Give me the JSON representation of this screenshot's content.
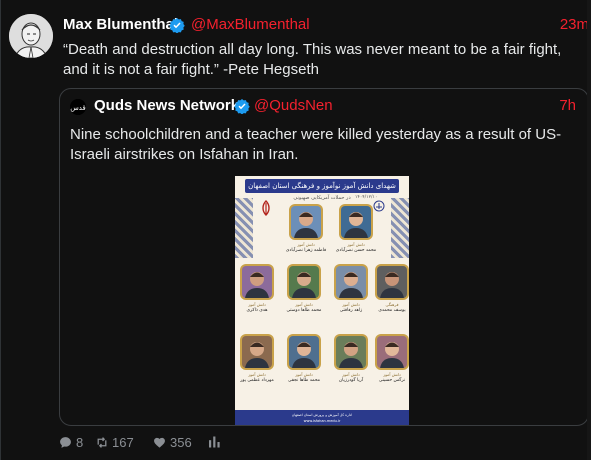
{
  "post": {
    "author_name": "Max Blumenthal",
    "author_handle": "@MaxBlumenthal",
    "time": "23m",
    "text": "“Death and destruction all day long. This was never meant to be a fair fight, and it is not a fair fight.” -Pete Hegseth",
    "counts": {
      "replies": "8",
      "reposts": "167",
      "likes": "356"
    }
  },
  "quote": {
    "author_name": "Quds News Network",
    "author_handle": "@QudsNen",
    "time": "7h",
    "text": "Nine schoolchildren and a teacher were killed yesterday as a result of  US-Israeli airstrikes on Isfahan in Iran.",
    "avatar_label": "قدس"
  },
  "poster": {
    "title": "شهدای دانش آموز نوآموز و فرهنگی استان اصفهان",
    "subtitle": "در حملات آمریکایی صهیونی",
    "date": "۱۴۰۴/۱۲/۱۰",
    "people": [
      {
        "role": "دانش آموز",
        "name": "فاطمه زهرا نصرآبادی"
      },
      {
        "role": "دانش آموز",
        "name": "محمد حسن نصرآبادی"
      },
      {
        "role": "دانش آموز",
        "name": "هدی ذاکری"
      },
      {
        "role": "دانش آموز",
        "name": "محمد طاها دوستی"
      },
      {
        "role": "دانش آموز",
        "name": "زاهد رفاقتی"
      },
      {
        "role": "فرهنگی",
        "name": "یوسف محمدی"
      },
      {
        "role": "دانش آموز",
        "name": "مهرداد عظمی پور"
      },
      {
        "role": "دانش آموز",
        "name": "محمد طاها نجفی"
      },
      {
        "role": "دانش آموز",
        "name": "آریا گودرزیان"
      },
      {
        "role": "دانش آموز",
        "name": "نرگس حسینی"
      }
    ],
    "footer_1": "اداره کل آموزش و پرورش استان اصفهان",
    "footer_2": "www.isfahan.medu.ir"
  },
  "colors": {
    "background": "#111111",
    "accent_red": "#f4212e",
    "verified_blue": "#1d9bf0",
    "muted": "#8b8f94"
  },
  "icons": [
    "verified-badge-icon",
    "reply-icon",
    "repost-icon",
    "like-icon",
    "analytics-icon"
  ]
}
